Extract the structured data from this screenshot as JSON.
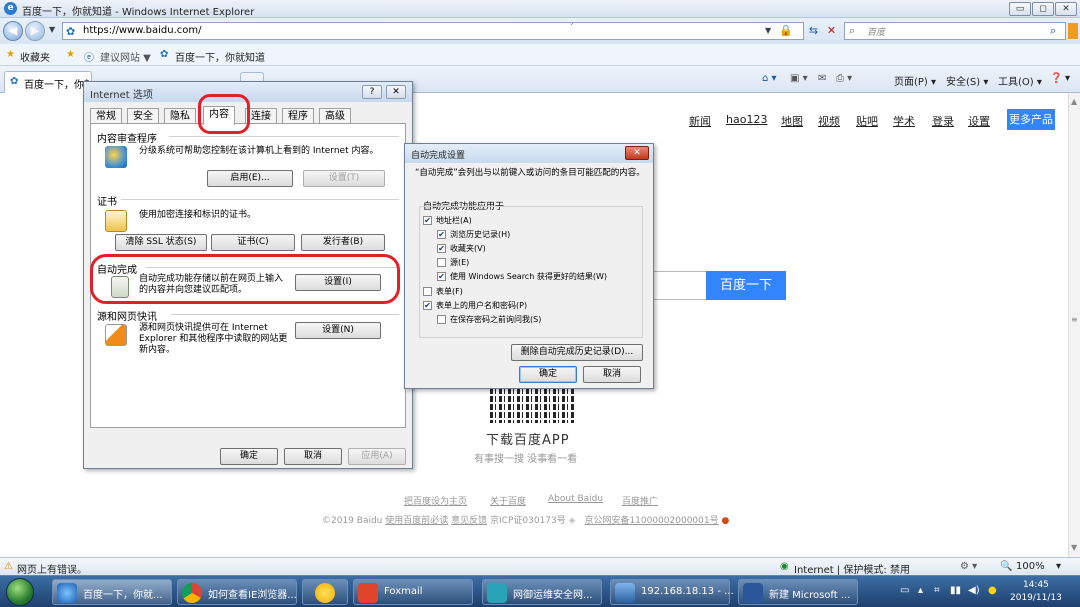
{
  "window": {
    "title": "百度一下，你就知道 - Windows Internet Explorer",
    "btn_min": "▭",
    "btn_max": "◻",
    "btn_close": "✕"
  },
  "address": {
    "url": "https://www.baidu.com/",
    "search_placeholder": "百度",
    "cursor_mark": "ˊ"
  },
  "favorites": {
    "label": "收藏夹",
    "suggested": "建议网站 ▼",
    "link": "百度一下，你就知道"
  },
  "tab": {
    "label": "百度一下，你就知道"
  },
  "toolbar": {
    "page": "页面(P) ▾",
    "safety": "安全(S) ▾",
    "tools": "工具(O) ▾",
    "help": "▾"
  },
  "baidu": {
    "nav": [
      "新闻",
      "hao123",
      "地图",
      "视频",
      "贴吧",
      "学术",
      "登录",
      "设置"
    ],
    "more": "更多产品",
    "search_button": "百度一下",
    "download_app": "下载百度APP",
    "download_sub": "有事搜一搜  没事看一看",
    "footer_links": [
      "把百度设为主页",
      "关于百度",
      "About Baidu",
      "百度推广"
    ],
    "copyright": "©2019 Baidu",
    "copyright_links": [
      "使用百度前必读",
      "意见反馈",
      "京ICP证030173号",
      "京公网安备11000002000001号"
    ]
  },
  "status": {
    "left": "网页上有错误。",
    "zone": "Internet | 保护模式: 禁用",
    "zoom": "100%"
  },
  "taskbar": {
    "items": [
      "百度一下，你就...",
      "如何查看IE浏览器...",
      "",
      "Foxmail",
      "网御运维安全网...",
      "192.168.18.13 - ...",
      "新建 Microsoft ..."
    ],
    "time": "14:45",
    "date": "2019/11/13"
  },
  "internet_options": {
    "title": "Internet 选项",
    "help_btn": "?",
    "close_btn": "✕",
    "tabs": [
      "常规",
      "安全",
      "隐私",
      "内容",
      "连接",
      "程序",
      "高级"
    ],
    "content_advisor": {
      "heading": "内容审查程序",
      "text": "分级系统可帮助您控制在该计算机上看到的 Internet 内容。",
      "enable": "启用(E)...",
      "settings": "设置(T)"
    },
    "certificates": {
      "heading": "证书",
      "text": "使用加密连接和标识的证书。",
      "clear_ssl": "清除 SSL 状态(S)",
      "certs": "证书(C)",
      "publishers": "发行者(B)"
    },
    "autocomplete": {
      "heading": "自动完成",
      "text": "自动完成功能存储以前在网页上输入的内容并向您建议匹配项。",
      "settings": "设置(I)"
    },
    "feeds": {
      "heading": "源和网页快讯",
      "text": "源和网页快讯提供可在 Internet Explorer 和其他程序中读取的网站更新内容。",
      "settings": "设置(N)"
    },
    "ok": "确定",
    "cancel": "取消",
    "apply": "应用(A)"
  },
  "autocomplete_dialog": {
    "title": "自动完成设置",
    "intro": "“自动完成”会列出与以前键入或访问的条目可能匹配的内容。",
    "group": "自动完成功能应用于",
    "items": [
      {
        "label": "地址栏(A)",
        "checked": true,
        "indent": 0
      },
      {
        "label": "浏览历史记录(H)",
        "checked": true,
        "indent": 1
      },
      {
        "label": "收藏夹(V)",
        "checked": true,
        "indent": 1
      },
      {
        "label": "源(E)",
        "checked": false,
        "indent": 1
      },
      {
        "label": "使用 Windows Search 获得更好的结果(W)",
        "checked": true,
        "indent": 1
      },
      {
        "label": "表单(F)",
        "checked": false,
        "indent": 0
      },
      {
        "label": "表单上的用户名和密码(P)",
        "checked": true,
        "indent": 0
      },
      {
        "label": "在保存密码之前询问我(S)",
        "checked": false,
        "indent": 1
      }
    ],
    "delete_history": "删除自动完成历史记录(D)...",
    "ok": "确定",
    "cancel": "取消"
  },
  "colors": {
    "accent": "#3385ff",
    "annotation": "#e3202a"
  }
}
